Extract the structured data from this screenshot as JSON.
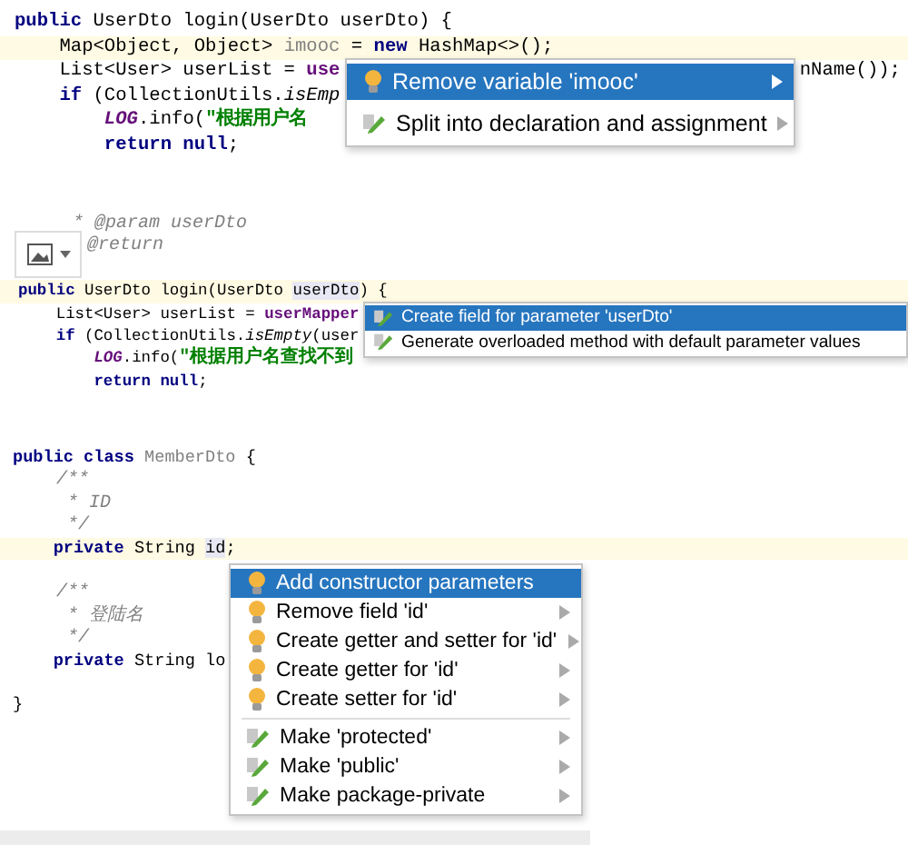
{
  "panels": [
    {
      "lines": [
        {
          "current": false,
          "segments": [
            {
              "kind": "kw",
              "text": "public"
            },
            {
              "kind": "plain",
              "text": " UserDto login(UserDto userDto) {"
            }
          ]
        },
        {
          "current": true,
          "segments": [
            {
              "kind": "plain",
              "text": "    Map<Object, Object> "
            },
            {
              "kind": "unused",
              "text": "imooc"
            },
            {
              "kind": "plain",
              "text": " = "
            },
            {
              "kind": "kw",
              "text": "new"
            },
            {
              "kind": "plain",
              "text": " HashMap<>();"
            }
          ]
        },
        {
          "current": false,
          "segments": [
            {
              "kind": "plain",
              "text": "    List<User> userList = "
            },
            {
              "kind": "field",
              "text": "use"
            }
          ],
          "tail": "nName());"
        },
        {
          "current": false,
          "segments": [
            {
              "kind": "kw",
              "text": "    if"
            },
            {
              "kind": "plain",
              "text": " (CollectionUtils."
            },
            {
              "kind": "italic",
              "text": "isEmp"
            }
          ]
        },
        {
          "current": false,
          "segments": [
            {
              "kind": "static",
              "text": "        LOG"
            },
            {
              "kind": "plain",
              "text": ".info("
            },
            {
              "kind": "str",
              "text": "\"根据用户名"
            }
          ]
        },
        {
          "current": false,
          "segments": [
            {
              "kind": "kw",
              "text": "        return null"
            },
            {
              "kind": "plain",
              "text": ";"
            }
          ]
        }
      ],
      "popup": {
        "items": [
          {
            "label": "Remove variable 'imooc'",
            "kind": "bulb",
            "submenu": true,
            "selected": true,
            "divider_before": false
          },
          {
            "label": "Split into declaration and assignment",
            "kind": "pencil",
            "submenu": true,
            "selected": false,
            "divider_before": false
          }
        ]
      }
    },
    {
      "lines": [
        {
          "current": false,
          "segments": [
            {
              "kind": "comment",
              "text": "     * @param userDto"
            }
          ]
        },
        {
          "current": false,
          "segments": [
            {
              "kind": "comment",
              "text": "@return"
            }
          ]
        },
        {
          "current": false
        },
        {
          "current": true,
          "segments": [
            {
              "kind": "kw",
              "text": "public"
            },
            {
              "kind": "plain",
              "text": " UserDto login(UserDto "
            },
            {
              "kind": "param",
              "text": "userDto"
            },
            {
              "kind": "plain",
              "text": ") {"
            }
          ]
        },
        {
          "current": false,
          "segments": [
            {
              "kind": "plain",
              "text": "    List<User> userList = "
            },
            {
              "kind": "field",
              "text": "userMapper"
            }
          ]
        },
        {
          "current": false,
          "segments": [
            {
              "kind": "kw",
              "text": "    if"
            },
            {
              "kind": "plain",
              "text": " (CollectionUtils."
            },
            {
              "kind": "italic",
              "text": "isEmpty"
            },
            {
              "kind": "plain",
              "text": "(user"
            }
          ]
        },
        {
          "current": false,
          "segments": [
            {
              "kind": "static",
              "text": "        LOG"
            },
            {
              "kind": "plain",
              "text": ".info("
            },
            {
              "kind": "str",
              "text": "\"根据用户名查找不到"
            }
          ]
        },
        {
          "current": false,
          "segments": [
            {
              "kind": "kw",
              "text": "        return null"
            },
            {
              "kind": "plain",
              "text": ";"
            }
          ]
        }
      ],
      "popup": {
        "items": [
          {
            "label": "Create field for parameter 'userDto'",
            "kind": "pencil",
            "submenu": false,
            "selected": true,
            "divider_before": false
          },
          {
            "label": "Generate overloaded method with default parameter values",
            "kind": "pencil",
            "submenu": false,
            "selected": false,
            "divider_before": false
          }
        ]
      }
    },
    {
      "lines": [
        {
          "current": false,
          "segments": [
            {
              "kind": "kw",
              "text": "public class"
            },
            {
              "kind": "unused",
              "text": " MemberDto"
            },
            {
              "kind": "plain",
              "text": " {"
            }
          ]
        },
        {
          "current": false,
          "segments": [
            {
              "kind": "comment",
              "text": "    /**"
            }
          ]
        },
        {
          "current": false,
          "segments": [
            {
              "kind": "comment",
              "text": "     * ID"
            }
          ]
        },
        {
          "current": false,
          "segments": [
            {
              "kind": "comment",
              "text": "     */"
            }
          ]
        },
        {
          "current": true,
          "segments": [
            {
              "kind": "kw",
              "text": "    private"
            },
            {
              "kind": "plain",
              "text": " String "
            },
            {
              "kind": "param",
              "text": "id"
            },
            {
              "kind": "plain",
              "text": ";"
            }
          ]
        },
        {
          "current": false
        },
        {
          "current": false,
          "segments": [
            {
              "kind": "comment",
              "text": "    /**"
            }
          ]
        },
        {
          "current": false,
          "segments": [
            {
              "kind": "comment",
              "text": "     * 登陆名"
            }
          ]
        },
        {
          "current": false,
          "segments": [
            {
              "kind": "comment",
              "text": "     */"
            }
          ]
        },
        {
          "current": false,
          "segments": [
            {
              "kind": "kw",
              "text": "    private"
            },
            {
              "kind": "plain",
              "text": " String lo"
            }
          ]
        },
        {
          "current": false
        },
        {
          "current": false,
          "segments": [
            {
              "kind": "plain",
              "text": "}"
            }
          ]
        }
      ],
      "popup": {
        "items": [
          {
            "label": "Add constructor parameters",
            "kind": "bulb",
            "submenu": false,
            "selected": true,
            "divider_before": false
          },
          {
            "label": "Remove field 'id'",
            "kind": "bulb",
            "submenu": true,
            "selected": false,
            "divider_before": false
          },
          {
            "label": "Create getter and setter for 'id'",
            "kind": "bulb",
            "submenu": true,
            "selected": false,
            "divider_before": false
          },
          {
            "label": "Create getter for 'id'",
            "kind": "bulb",
            "submenu": true,
            "selected": false,
            "divider_before": false
          },
          {
            "label": "Create setter for 'id'",
            "kind": "bulb",
            "submenu": true,
            "selected": false,
            "divider_before": false
          },
          {
            "label": "Make 'protected'",
            "kind": "pencil",
            "submenu": true,
            "selected": false,
            "divider_before": true
          },
          {
            "label": "Make 'public'",
            "kind": "pencil",
            "submenu": true,
            "selected": false,
            "divider_before": false
          },
          {
            "label": "Make package-private",
            "kind": "pencil",
            "submenu": true,
            "selected": false,
            "divider_before": false
          }
        ]
      }
    }
  ]
}
